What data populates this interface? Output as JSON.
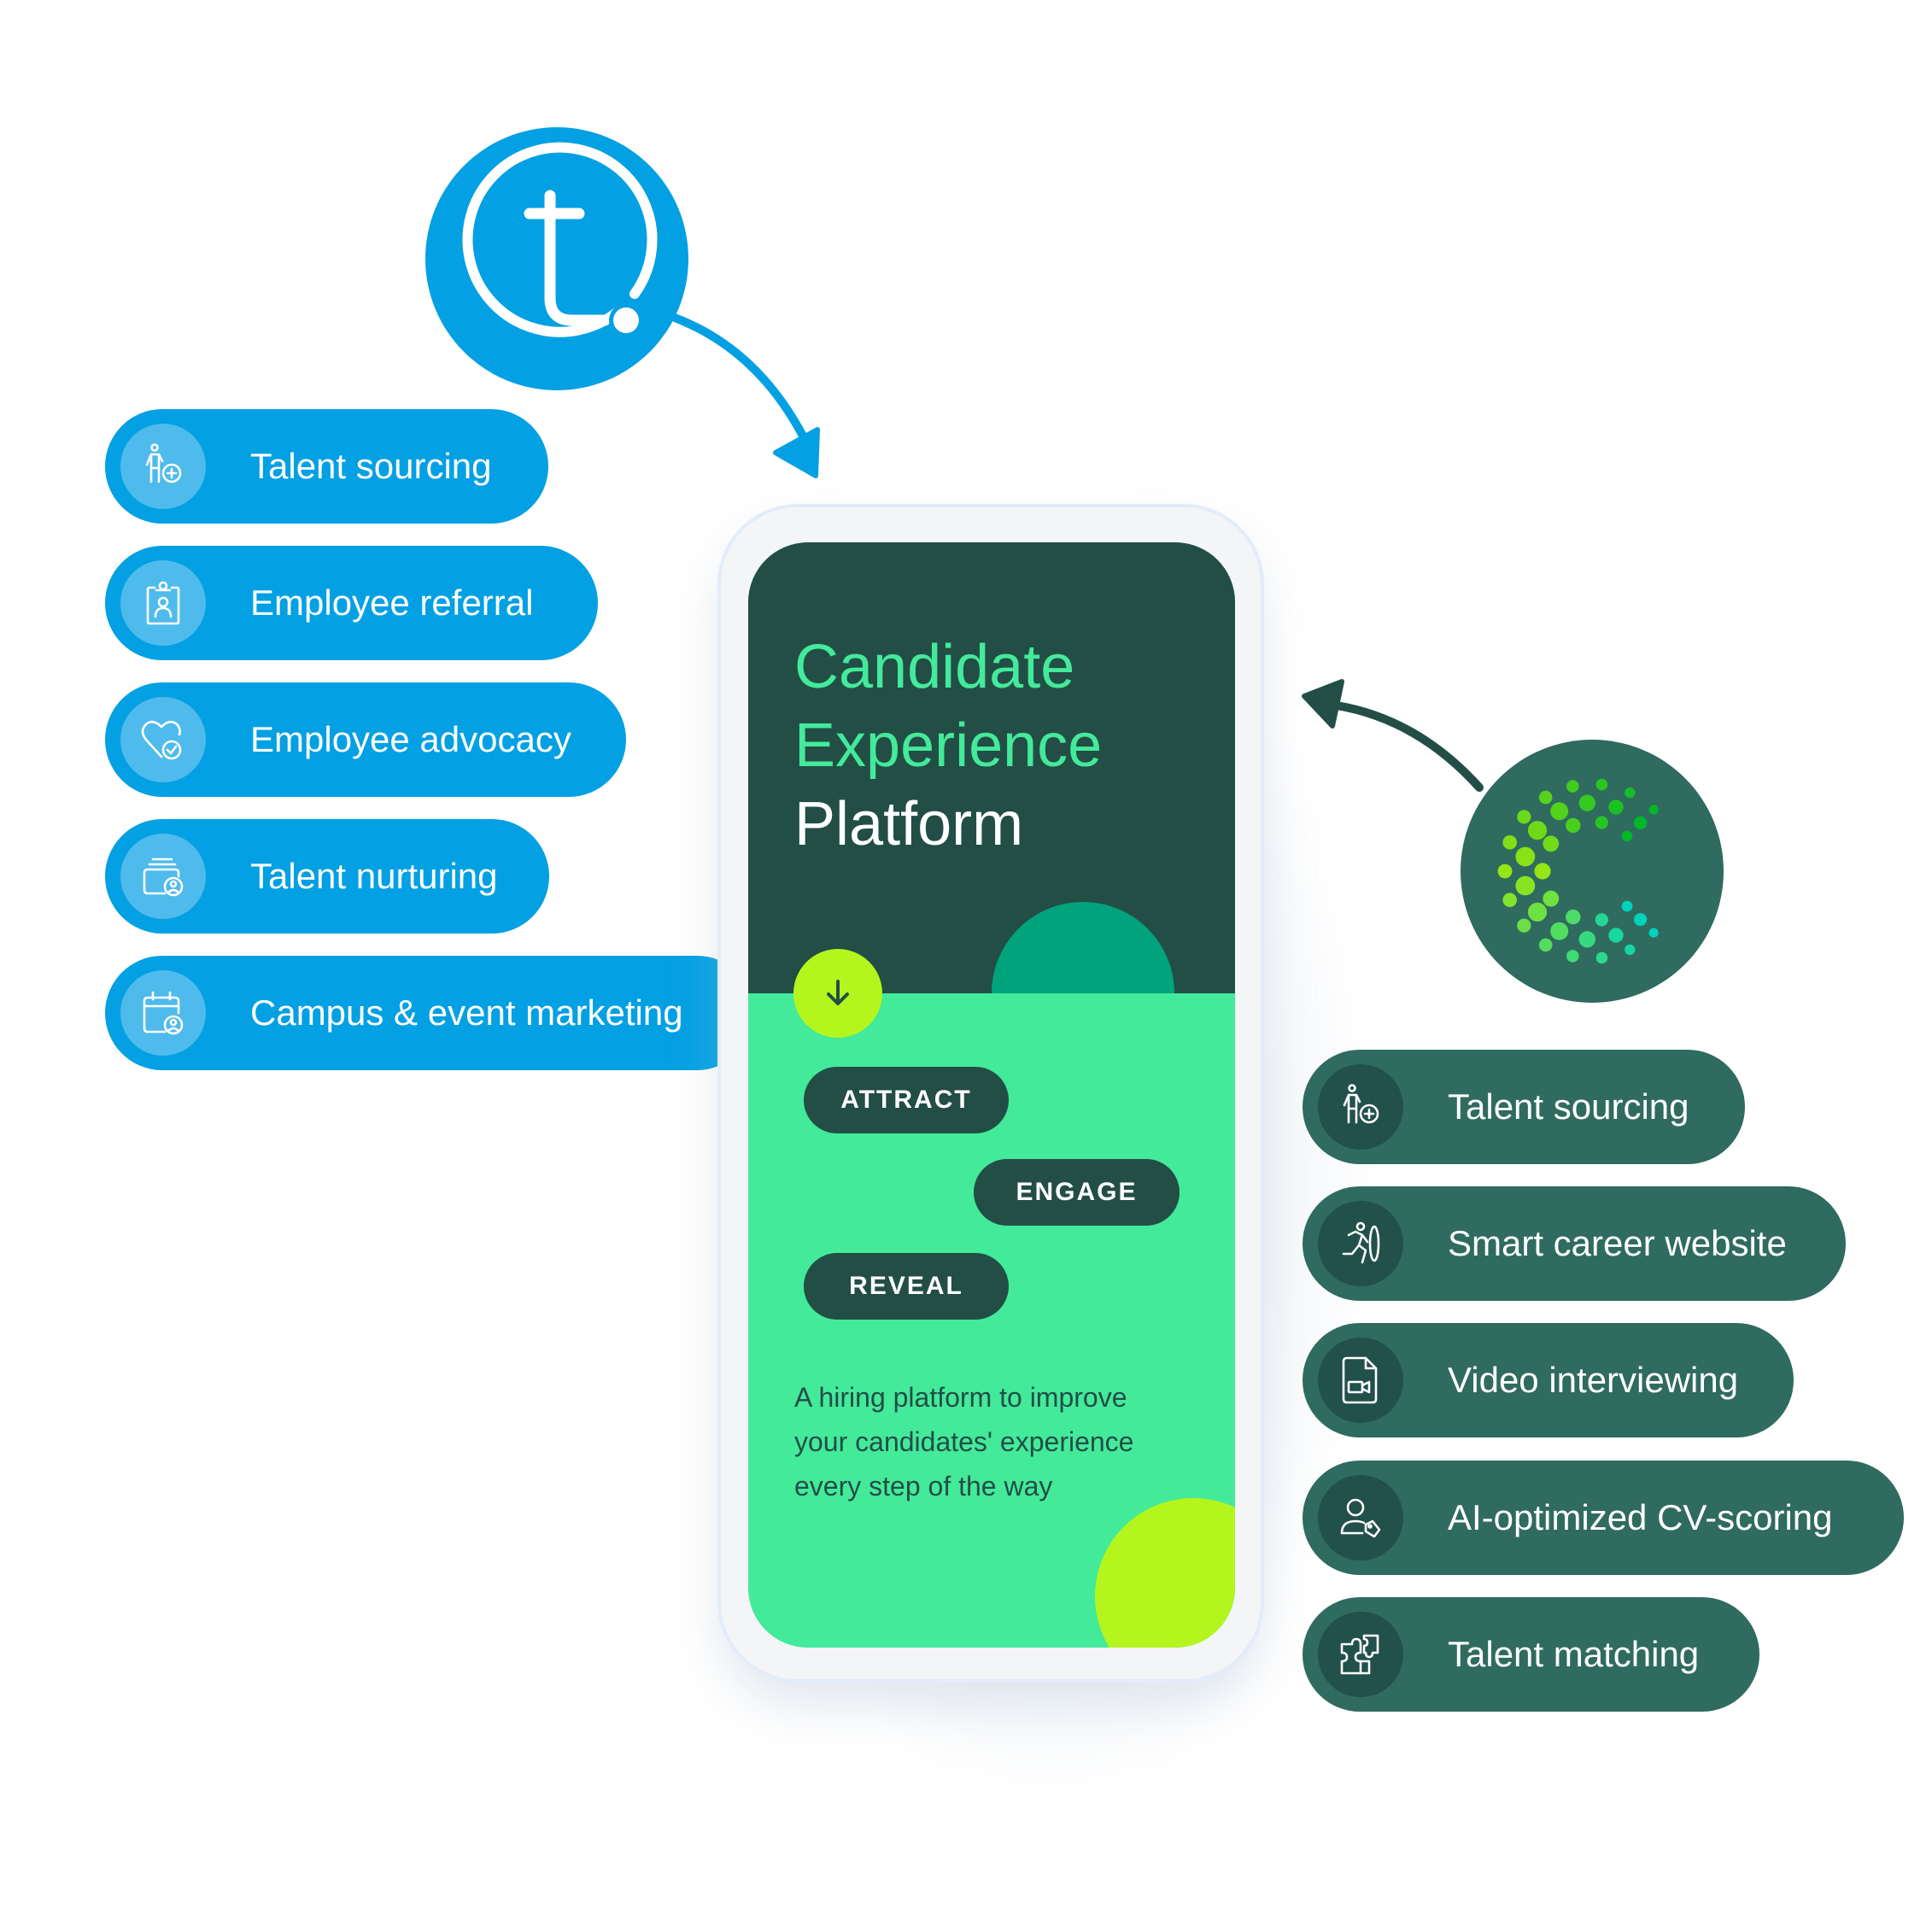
{
  "brand_left": {
    "name": "teamtailor-style logo",
    "icon": "t-logo-icon",
    "color": "#03A0E3"
  },
  "brand_right": {
    "name": "dotted C logo",
    "icon": "dotted-c-logo-icon",
    "color": "#2F6B5E"
  },
  "left_features": [
    {
      "label": "Talent sourcing",
      "icon": "person-add-icon"
    },
    {
      "label": "Employee referral",
      "icon": "id-badge-icon"
    },
    {
      "label": "Employee advocacy",
      "icon": "heart-check-icon"
    },
    {
      "label": "Talent nurturing",
      "icon": "stack-user-icon"
    },
    {
      "label": "Campus & event marketing",
      "icon": "calendar-user-icon"
    }
  ],
  "right_features": [
    {
      "label": "Talent sourcing",
      "icon": "person-add-icon"
    },
    {
      "label": "Smart career website",
      "icon": "person-running-door-icon"
    },
    {
      "label": "Video interviewing",
      "icon": "video-file-icon"
    },
    {
      "label": "AI-optimized CV-scoring",
      "icon": "user-tag-icon"
    },
    {
      "label": "Talent matching",
      "icon": "puzzle-icon"
    }
  ],
  "phone": {
    "title_line1": "Candidate",
    "title_line2": "Experience",
    "title_line3": "Platform",
    "scroll_icon": "arrow-down-icon",
    "stages": [
      "ATTRACT",
      "ENGAGE",
      "REVEAL"
    ],
    "description": "A hiring platform to improve your candidates' experience every step of the way",
    "description_lines": [
      "A hiring platform to improve",
      "your candidates' experience",
      "every step of the way"
    ]
  },
  "colors": {
    "blue": "#03A0E3",
    "blue_light": "#4FBBEC",
    "dark_green": "#224E46",
    "pill_green": "#2F6B5E",
    "mint": "#43EA9A",
    "lime": "#B4F51E",
    "teal": "#00A37C"
  }
}
